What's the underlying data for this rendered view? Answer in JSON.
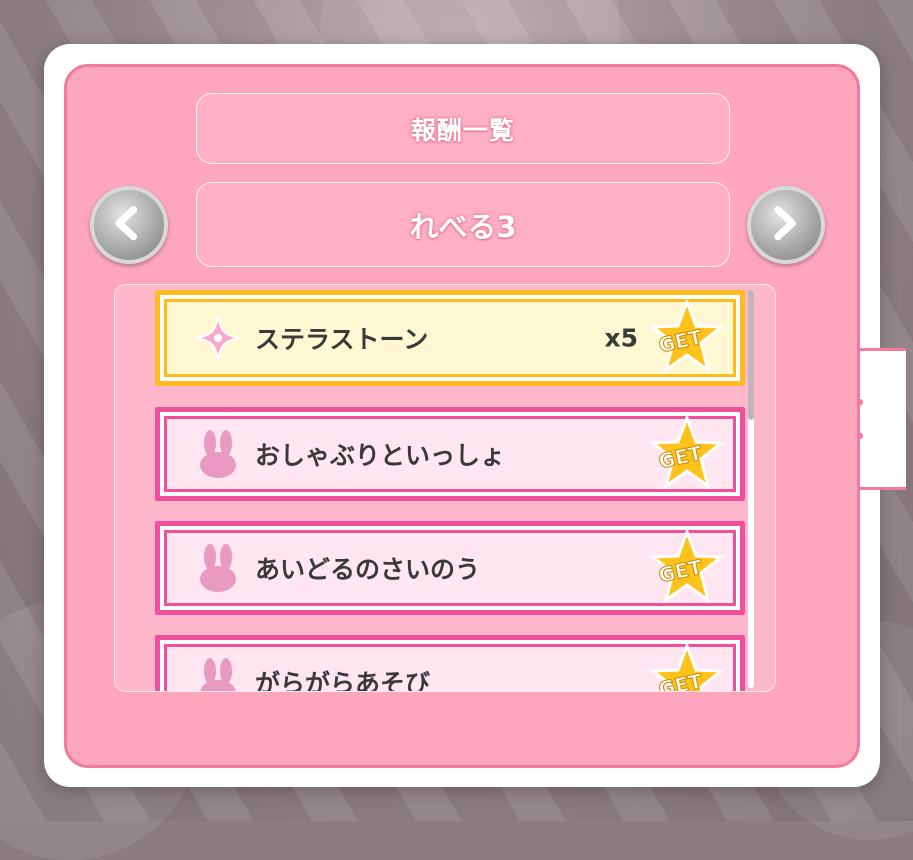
{
  "dialog": {
    "title": "報酬一覧",
    "level": "れべる3"
  },
  "rewards": [
    {
      "name": "ステラストーン",
      "quantity": "x5",
      "icon": "sparkle-star-icon",
      "style": "gold",
      "badge": "GET"
    },
    {
      "name": "おしゃぶりといっしょ",
      "quantity": "",
      "icon": "bunny-icon",
      "style": "pink",
      "badge": "GET"
    },
    {
      "name": "あいどるのさいのう",
      "quantity": "",
      "icon": "bunny-icon",
      "style": "pink",
      "badge": "GET"
    },
    {
      "name": "がらがらあそび",
      "quantity": "",
      "icon": "bunny-icon",
      "style": "pink",
      "badge": "GET"
    }
  ],
  "colors": {
    "panel": "#ffa6bf",
    "panel_border": "#f27a9c",
    "gold_frame": "#ffbb1c",
    "pink_frame": "#f0509a",
    "close_x": "#f27a9c"
  }
}
